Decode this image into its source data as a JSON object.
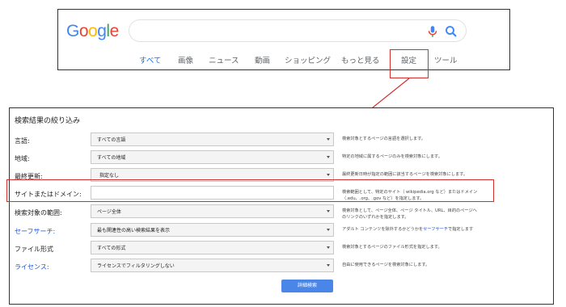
{
  "logo": {
    "letters": [
      "G",
      "o",
      "o",
      "g",
      "l",
      "e"
    ],
    "colors": [
      "#4285f4",
      "#ea4335",
      "#fbbc05",
      "#4285f4",
      "#34a853",
      "#ea4335"
    ]
  },
  "search": {
    "placeholder": "",
    "mic_icon": "mic-icon",
    "search_icon": "search-icon"
  },
  "tabs": [
    {
      "label": "すべて",
      "active": true
    },
    {
      "label": "画像"
    },
    {
      "label": "ニュース"
    },
    {
      "label": "動画"
    },
    {
      "label": "ショッピング"
    },
    {
      "label": "もっと見る"
    },
    {
      "label": "設定"
    },
    {
      "label": "ツール"
    }
  ],
  "advanced": {
    "title": "検索結果の絞り込み",
    "rows": [
      {
        "label": "言語:",
        "control": "select",
        "value": "すべての言語",
        "desc": [
          "検索対象とするページの言語を選択します。"
        ]
      },
      {
        "label": "地域:",
        "control": "select",
        "value": "すべての地域",
        "desc": [
          "特定の地域に属するページのみを検索対象にします。"
        ]
      },
      {
        "label": "最終更新:",
        "control": "select",
        "value": "指定なし",
        "desc": [
          "最終更新日時が指定の範囲に該当するページを検索対象にします。"
        ]
      },
      {
        "label": "サイトまたはドメイン:",
        "control": "text",
        "value": "",
        "desc": [
          "検索範囲として、特定のサイト（ wikipedia.org など）またはドメイン",
          "（.edu、.org、.gov など）を指定します。"
        ]
      },
      {
        "label": "検索対象の範囲:",
        "control": "select",
        "value": "ページ全体",
        "desc": [
          "検索対象として、ページ全体、ページ タイトル、URL、目的のページへ",
          "のリンクのいずれかを指定します。"
        ]
      },
      {
        "label": "セーフサーチ:",
        "control": "select",
        "value": "最も関連性の高い検索結果を表示",
        "link": true,
        "desc": [
          "アダルト コンテンツを除外するかどうかを",
          "セーフサーチ",
          "で指定します"
        ]
      },
      {
        "label": "ファイル形式",
        "control": "select",
        "value": "すべての形式",
        "desc": [
          "検索対象とするページのファイル形式を指定します。"
        ]
      },
      {
        "label": "ライセンス:",
        "control": "select",
        "value": "ライセンスでフィルタリングしない",
        "link": true,
        "desc": [
          "自由に使用できるページを検索対象にします。"
        ]
      }
    ],
    "submit_label": "詳細検索"
  },
  "highlight_color": "#d32f2f"
}
